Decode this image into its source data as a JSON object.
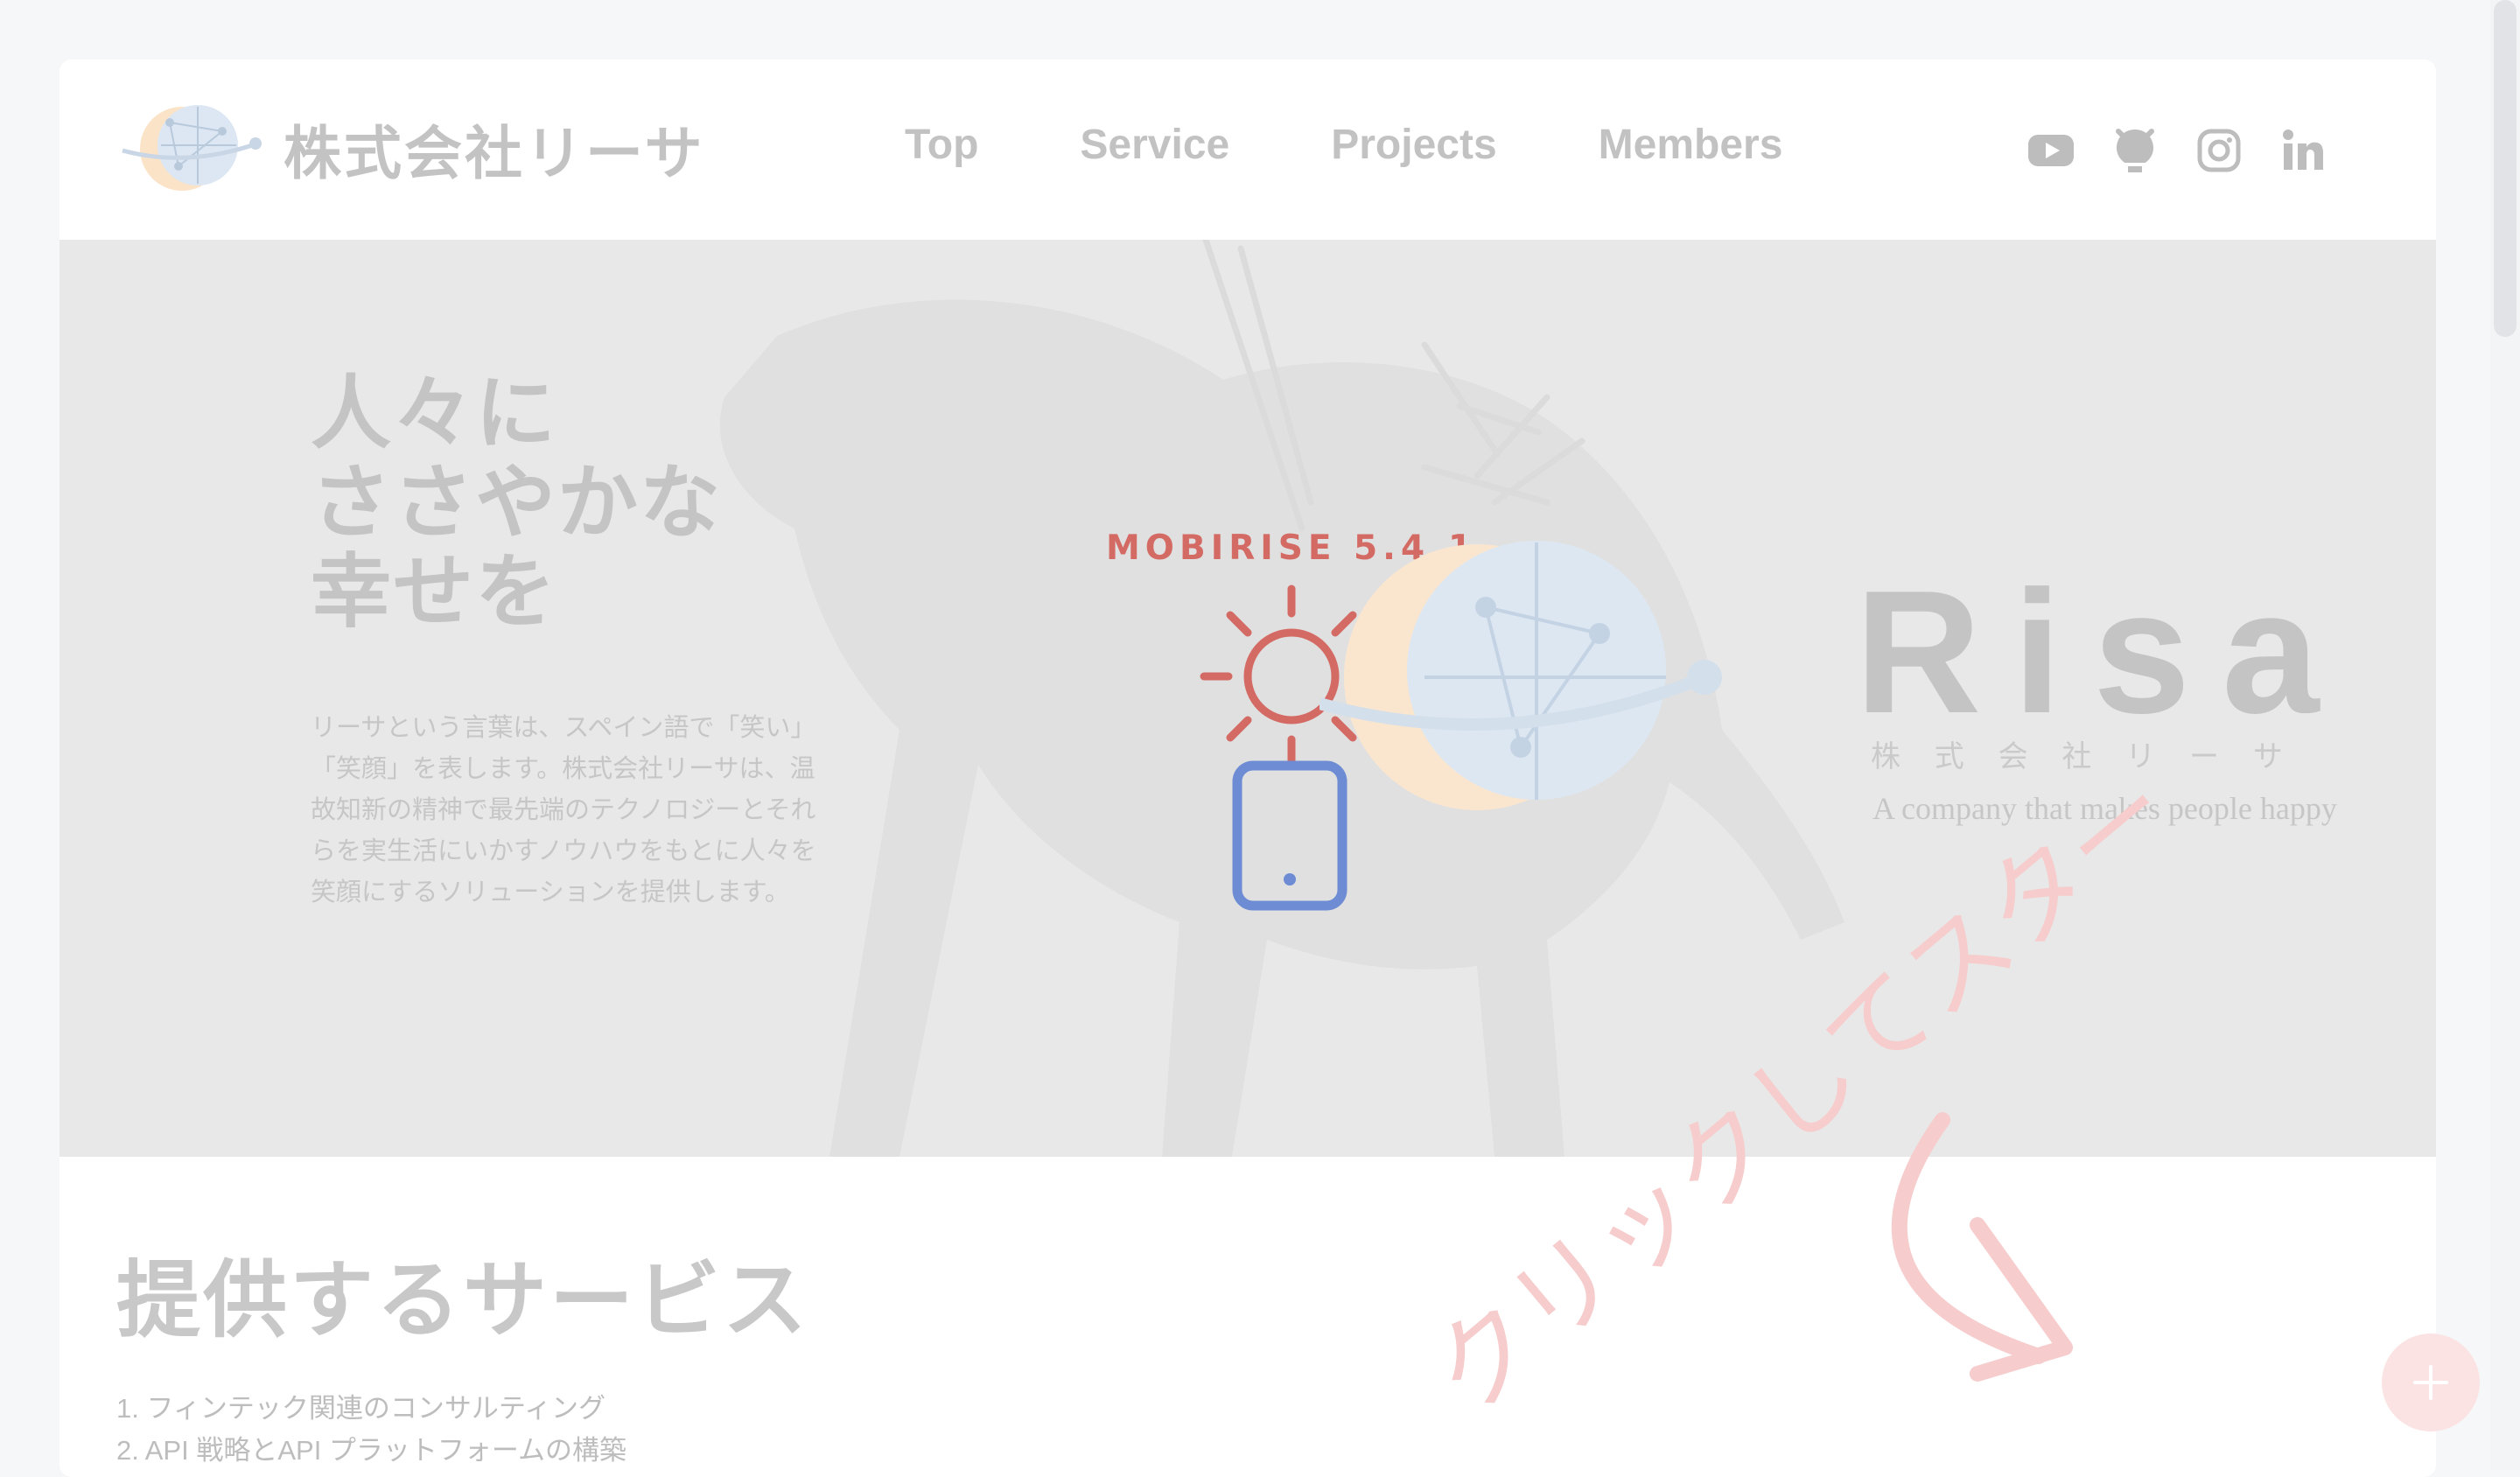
{
  "header": {
    "brand_name": "株式会社リーサ",
    "nav": [
      {
        "label": "Top"
      },
      {
        "label": "Service"
      },
      {
        "label": "Projects"
      },
      {
        "label": "Members"
      }
    ],
    "social": [
      "youtube-icon",
      "github-icon",
      "instagram-icon",
      "linkedin-icon"
    ]
  },
  "hero": {
    "title_lines": [
      "人々に",
      "ささやかな",
      "幸せを"
    ],
    "description": "リーサという言葉は、スペイン語で「笑い」「笑顔」を表します。株式会社リーサは、温故知新の精神で最先端のテクノロジーとそれらを実生活にいかすノウハウをもとに人々を笑顔にするソリューションを提供します。",
    "badge": "MOBIRISE  5.4.1",
    "logo": {
      "wordmark": "Risa",
      "subtitle": "株 式 会 社 リ ー サ",
      "tagline": "A company that makes people happy"
    }
  },
  "services": {
    "title": "提供するサービス",
    "items": [
      "1. フィンテック関連のコンサルティング",
      "2. API 戦略とAPI プラットフォームの構築"
    ]
  },
  "overlay": {
    "hint_text": "クリックしてスタート"
  },
  "colors": {
    "accent": "#d46a64",
    "phone_blue": "#6d8cd4",
    "hint_pink": "#f6cccc",
    "text_muted": "#c3c3c3"
  }
}
